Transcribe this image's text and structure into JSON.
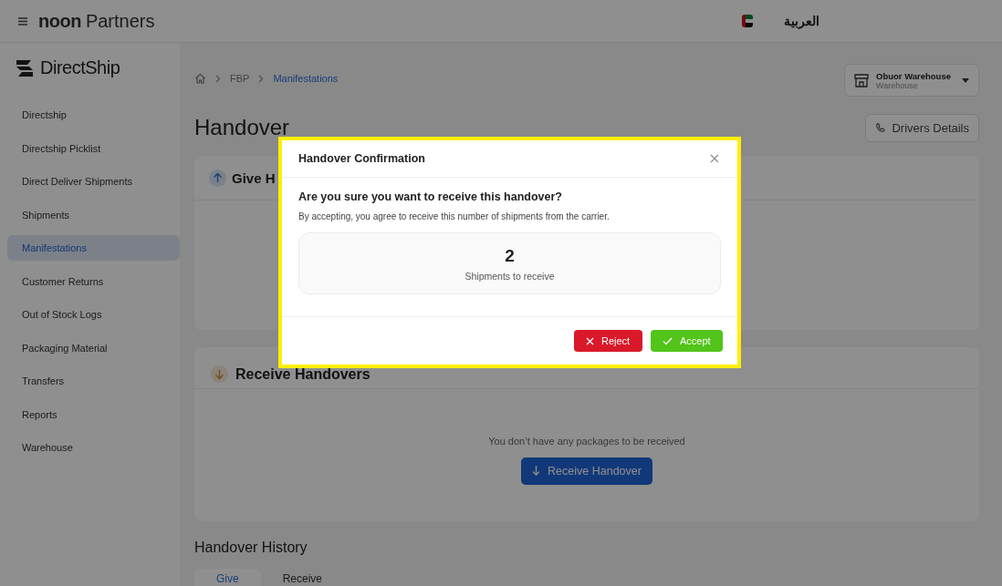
{
  "top_bar": {
    "brand_bold": "noon",
    "brand_rest": "Partners",
    "language": "العربية"
  },
  "sidebar": {
    "logo": "DirectShip",
    "items": [
      {
        "label": "Directship",
        "selected": false
      },
      {
        "label": "Directship Picklist",
        "selected": false
      },
      {
        "label": "Direct Deliver Shipments",
        "selected": false
      },
      {
        "label": "Shipments",
        "selected": false
      },
      {
        "label": "Manifestations",
        "selected": true
      },
      {
        "label": "Customer Returns",
        "selected": false
      },
      {
        "label": "Out of Stock Logs",
        "selected": false
      },
      {
        "label": "Packaging Material",
        "selected": false
      },
      {
        "label": "Transfers",
        "selected": false
      },
      {
        "label": "Reports",
        "selected": false
      },
      {
        "label": "Warehouse",
        "selected": false
      }
    ]
  },
  "breadcrumb": [
    "FBP",
    "Manifestations"
  ],
  "warehouse": {
    "name": "Obuor Warehouse",
    "type": "Warehouse"
  },
  "page_title": "Handover",
  "drivers_button": "Drivers Details",
  "give_card": {
    "title": "Give H"
  },
  "receive_card": {
    "title": "Receive Handovers",
    "empty_text": "You don’t have any packages to be received",
    "button": "Receive Handover"
  },
  "history": {
    "title": "Handover History",
    "tabs": [
      {
        "label": "Give",
        "selected": true
      },
      {
        "label": "Receive",
        "selected": false
      }
    ]
  },
  "modal": {
    "title": "Handover Confirmation",
    "question": "Are you sure you want to receive this handover?",
    "description": "By accepting, you agree to receive this number of shipments from the carrier.",
    "count": "2",
    "count_label": "Shipments to receive",
    "reject": "Reject",
    "accept": "Accept"
  }
}
